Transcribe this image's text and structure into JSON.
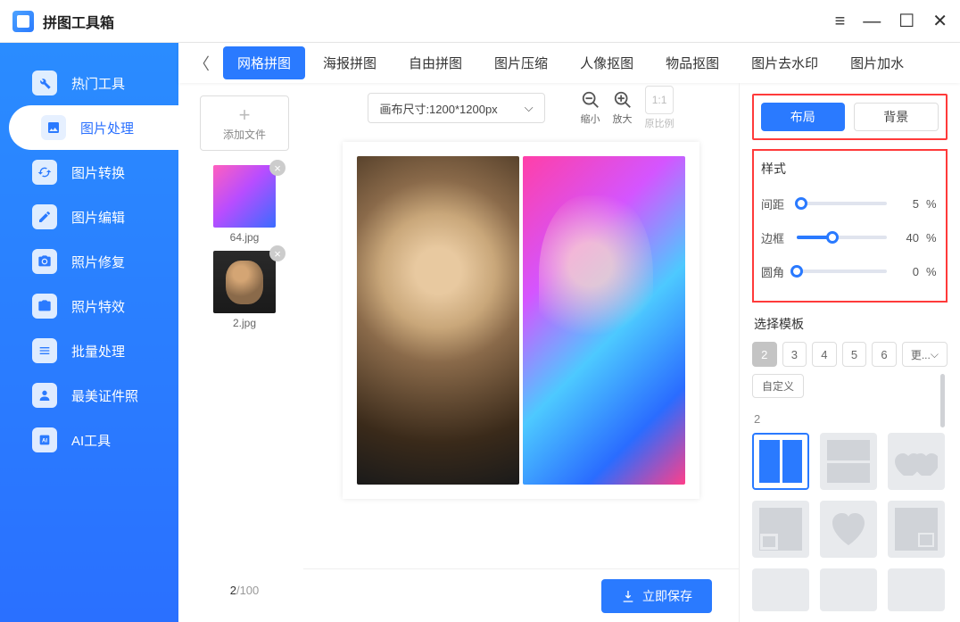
{
  "app": {
    "title": "拼图工具箱"
  },
  "window": {
    "menu": "≡",
    "min": "—",
    "max": "☐",
    "close": "✕"
  },
  "sidebar": {
    "items": [
      {
        "label": "热门工具"
      },
      {
        "label": "图片处理"
      },
      {
        "label": "图片转换"
      },
      {
        "label": "图片编辑"
      },
      {
        "label": "照片修复"
      },
      {
        "label": "照片特效"
      },
      {
        "label": "批量处理"
      },
      {
        "label": "最美证件照"
      },
      {
        "label": "AI工具"
      }
    ]
  },
  "tabs": {
    "back": "〈",
    "items": [
      "网格拼图",
      "海报拼图",
      "自由拼图",
      "图片压缩",
      "人像抠图",
      "物品抠图",
      "图片去水印",
      "图片加水"
    ]
  },
  "files": {
    "add_label": "添加文件",
    "items": [
      {
        "name": "64.jpg"
      },
      {
        "name": "2.jpg"
      }
    ],
    "count_cur": "2",
    "count_sep": "/",
    "count_max": "100"
  },
  "canvas": {
    "size_label": "画布尺寸:1200*1200px",
    "zoom_out": "缩小",
    "zoom_in": "放大",
    "ratio_btn": "1:1",
    "ratio_label": "原比例"
  },
  "save": {
    "label": "立即保存"
  },
  "rpanel": {
    "seg": {
      "layout": "布局",
      "background": "背景"
    },
    "style_title": "样式",
    "sliders": {
      "spacing": {
        "label": "间距",
        "value": "5",
        "unit": "%"
      },
      "border": {
        "label": "边框",
        "value": "40",
        "unit": "%"
      },
      "radius": {
        "label": "圆角",
        "value": "0",
        "unit": "%"
      }
    },
    "template_title": "选择模板",
    "nums": [
      "2",
      "3",
      "4",
      "5",
      "6"
    ],
    "more": "更...",
    "custom": "自定义",
    "grid_label": "2"
  }
}
